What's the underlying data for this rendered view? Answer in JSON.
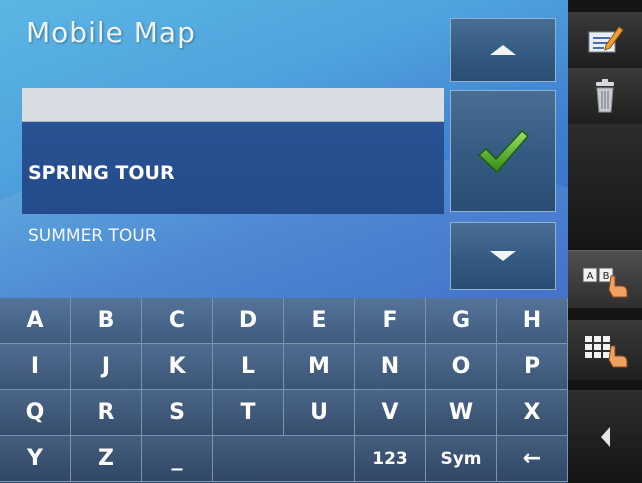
{
  "app": {
    "title": "Mobile Map"
  },
  "list": {
    "items": [
      {
        "label": ""
      },
      {
        "label": "SPRING TOUR",
        "selected": true
      },
      {
        "label": "SUMMER TOUR"
      }
    ]
  },
  "controls": {
    "scroll_up_icon": "triangle-up-icon",
    "confirm_icon": "green-checkmark-icon",
    "scroll_down_icon": "triangle-down-icon"
  },
  "keyboard": {
    "rows": [
      [
        "A",
        "B",
        "C",
        "D",
        "E",
        "F",
        "G",
        "H"
      ],
      [
        "I",
        "J",
        "K",
        "L",
        "M",
        "N",
        "O",
        "P"
      ],
      [
        "Q",
        "R",
        "S",
        "T",
        "U",
        "V",
        "W",
        "X"
      ],
      [
        "Y",
        "Z",
        "_",
        "",
        "",
        "123",
        "Sym",
        "←"
      ]
    ]
  },
  "sidebar": {
    "items": [
      {
        "name": "edit",
        "icon": "notepad-pencil-icon"
      },
      {
        "name": "delete",
        "icon": "trash-can-icon"
      },
      {
        "name": "abc-keyboard",
        "icon": "ab-keys-hand-icon"
      },
      {
        "name": "numeric-keyboard",
        "icon": "keypad-hand-icon"
      },
      {
        "name": "back",
        "icon": "triangle-left-icon"
      }
    ]
  },
  "colors": {
    "accent_blue": "#3f7fcf",
    "selected_row": "#285293",
    "check_green": "#3d9a1b",
    "sidebar_bg": "#141414"
  }
}
